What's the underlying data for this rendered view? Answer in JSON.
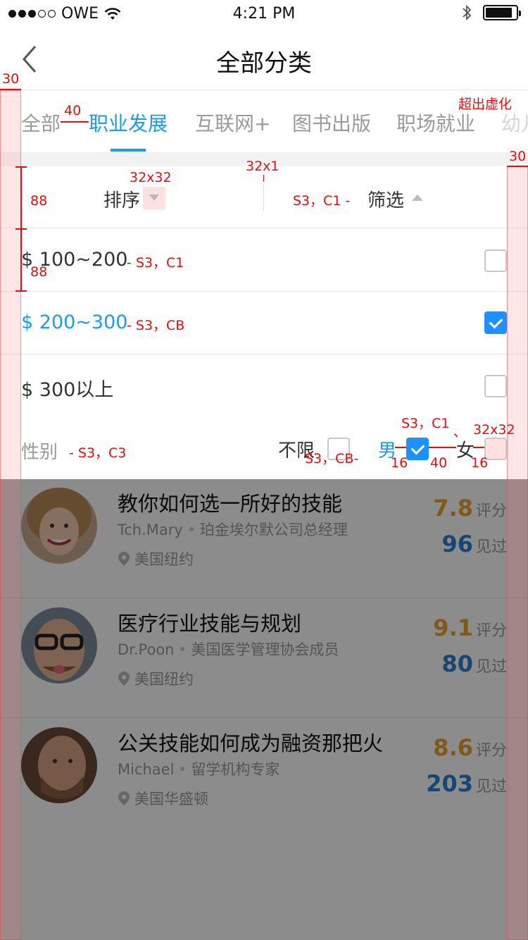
{
  "status_bar": {
    "carrier": "OWE",
    "time": "4:21 PM",
    "battery_fraction": 0.9
  },
  "nav": {
    "title": "全部分类"
  },
  "tabs": [
    "全部",
    "职业发展",
    "互联网+",
    "图书出版",
    "职场就业",
    "幼儿"
  ],
  "active_tab": "职业发展",
  "sort": {
    "label": "排序"
  },
  "filter": {
    "label": "筛选"
  },
  "price_options": [
    {
      "label": "$ 100~200",
      "checked": false
    },
    {
      "label": "$ 200~300",
      "checked": true
    },
    {
      "label": "$ 300以上",
      "checked": false
    }
  ],
  "gender": {
    "label": "性别",
    "options": [
      {
        "label": "不限",
        "checked": false
      },
      {
        "label": "男",
        "checked": true
      },
      {
        "label": "女",
        "checked": false
      }
    ]
  },
  "cards": [
    {
      "title": "教你如何选一所好的技能",
      "author": "Tch.Mary",
      "role": "珀金埃尔默公司总经理",
      "location": "美国纽约",
      "score": "7.8",
      "score_unit": "评分",
      "seen": "96",
      "seen_unit": "见过"
    },
    {
      "title": "医疗行业技能与规划",
      "author": "Dr.Poon",
      "role": "美国医学管理协会成员",
      "location": "美国纽约",
      "score": "9.1",
      "score_unit": "评分",
      "seen": "80",
      "seen_unit": "见过"
    },
    {
      "title": "公关技能如何成为融资那把火",
      "author": "Michael",
      "role": "留学机构专家",
      "location": "美国华盛顿",
      "score": "8.6",
      "score_unit": "评分",
      "seen": "203",
      "seen_unit": "见过"
    }
  ],
  "annotations": {
    "margin_left": "30",
    "tab_gap": "40",
    "overflow_blur": "超出虚化",
    "margin_right": "30",
    "icon_size": "32x32",
    "divider_size": "32x1",
    "row_height_a": "88",
    "row_height_b": "88",
    "filter_style": "S3，C1 -",
    "price1_style": "-   S3，C1",
    "price2_style": "-   S3，CB",
    "gender_style": "-   S3，C3",
    "male_style": "S3，C1",
    "comma_mark": "、",
    "checkbox_size": "32x32",
    "unlimited_style": "S3，CB-",
    "gap16a": "16",
    "gap40": "40",
    "gap16b": "16"
  }
}
